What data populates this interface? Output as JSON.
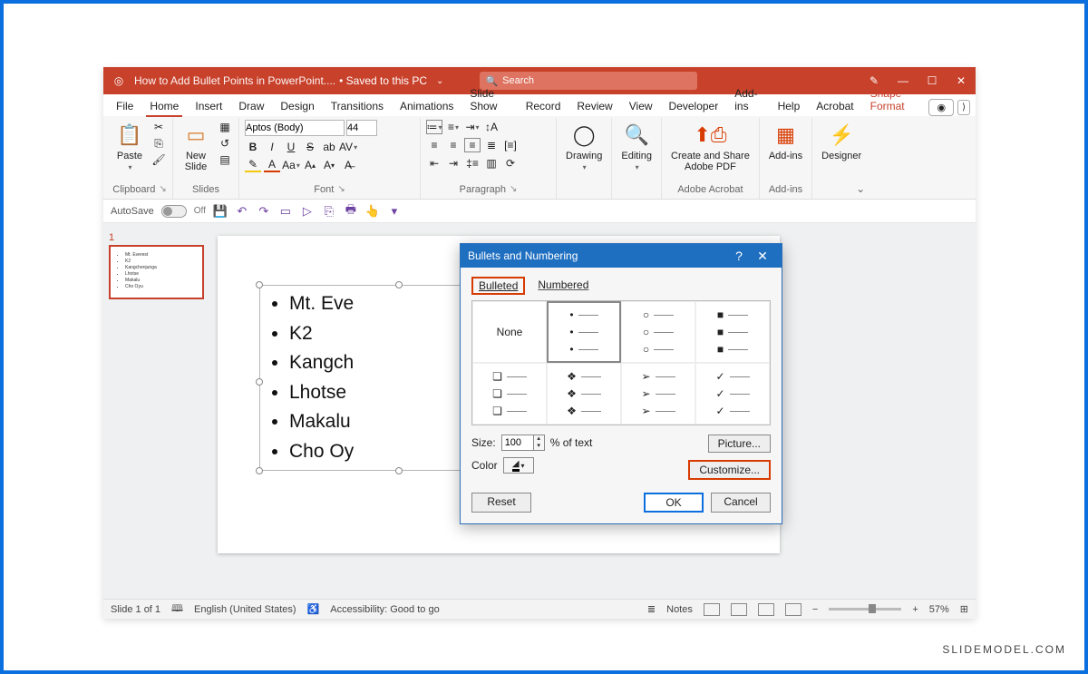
{
  "title": {
    "doc": "How to Add Bullet Points in PowerPoint....",
    "savestate": "• Saved to this PC",
    "search_placeholder": "Search"
  },
  "wincontrols": {
    "min": "—",
    "max": "☐",
    "close": "✕"
  },
  "tabs": [
    "File",
    "Home",
    "Insert",
    "Draw",
    "Design",
    "Transitions",
    "Animations",
    "Slide Show",
    "Record",
    "Review",
    "View",
    "Developer",
    "Add-ins",
    "Help",
    "Acrobat",
    "Shape Format"
  ],
  "ribbon": {
    "clipboard": {
      "paste": "Paste",
      "label": "Clipboard"
    },
    "slides": {
      "newslide": "New\nSlide",
      "label": "Slides"
    },
    "font": {
      "name": "Aptos (Body)",
      "size": "44",
      "label": "Font"
    },
    "paragraph": {
      "label": "Paragraph"
    },
    "drawing": {
      "label": "Drawing"
    },
    "editing": {
      "label": "Editing"
    },
    "acrobat": {
      "btn": "Create and Share\nAdobe PDF",
      "label": "Adobe Acrobat"
    },
    "addins": {
      "btn": "Add-ins",
      "label": "Add-ins"
    },
    "designer": {
      "btn": "Designer"
    }
  },
  "qat": {
    "autosave": "AutoSave",
    "autosave_state": "Off"
  },
  "thumb": {
    "num": "1",
    "items": [
      "Mt. Everest",
      "K2",
      "Kangchenjunga",
      "Lhotse",
      "Makalu",
      "Cho Oyu"
    ]
  },
  "slide": {
    "bullets": [
      "Mt. Eve",
      "K2",
      "Kangch",
      "Lhotse",
      "Makalu",
      "Cho Oy"
    ]
  },
  "dialog": {
    "title": "Bullets and Numbering",
    "tabs": {
      "bulleted": "Bulleted",
      "numbered": "Numbered"
    },
    "none": "None",
    "size_label": "Size:",
    "size_value": "100",
    "pct": "% of text",
    "color_label": "Color",
    "picture": "Picture...",
    "customize": "Customize...",
    "reset": "Reset",
    "ok": "OK",
    "cancel": "Cancel"
  },
  "status": {
    "slide": "Slide 1 of 1",
    "lang": "English (United States)",
    "access": "Accessibility: Good to go",
    "notes": "Notes",
    "zoom": "57%"
  },
  "watermark": "SLIDEMODEL.COM"
}
